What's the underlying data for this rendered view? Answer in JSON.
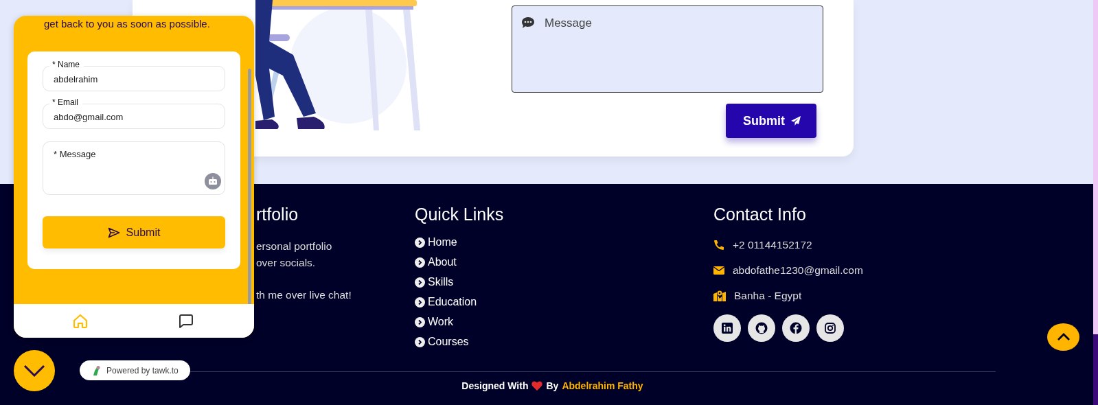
{
  "contact_form": {
    "message": {
      "placeholder": "Message"
    },
    "submit": "Submit"
  },
  "footer": {
    "about": {
      "heading": "rtfolio",
      "lines": [
        "ersonal portfolio",
        "over socials."
      ],
      "chat_line": "th me over live chat!"
    },
    "quick_links": {
      "heading": "Quick Links",
      "items": [
        "Home",
        "About",
        "Skills",
        "Education",
        "Work",
        "Courses"
      ]
    },
    "contact_info": {
      "heading": "Contact Info",
      "items": [
        {
          "kind": "phone",
          "text": "+2 01144152172"
        },
        {
          "kind": "email",
          "text": "abdofathe1230@gmail.com"
        },
        {
          "kind": "location",
          "text": "Banha - Egypt"
        }
      ],
      "socials": [
        {
          "kind": "linkedin"
        },
        {
          "kind": "github"
        },
        {
          "kind": "facebook"
        },
        {
          "kind": "instagram"
        }
      ]
    },
    "credit": {
      "prefix": "Designed With",
      "middle": "By",
      "author": "Abdelrahim Fathy"
    }
  },
  "chat_widget": {
    "intro": "get back to you as soon as possible.",
    "fields": [
      {
        "kind": "input",
        "label": "* Name",
        "value": "abdelrahim"
      },
      {
        "kind": "input",
        "label": "* Email",
        "value": "abdo@gmail.com"
      },
      {
        "kind": "textarea",
        "placeholder": "* Message"
      }
    ],
    "submit": "Submit",
    "nav": [
      {
        "kind": "home",
        "selected": true
      },
      {
        "kind": "chat",
        "selected": false
      }
    ],
    "powered_by": "Powered by tawk.to"
  }
}
